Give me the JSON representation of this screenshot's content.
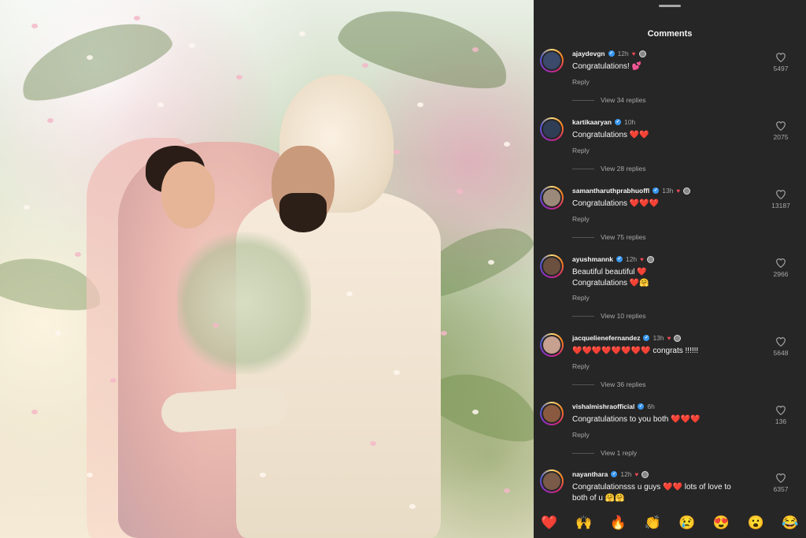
{
  "panel": {
    "title": "Comments"
  },
  "comments": [
    {
      "username": "ajaydevgn",
      "time": "12h",
      "text": "Congratulations! 💕",
      "reply": "Reply",
      "likes": "5497",
      "view_replies": "View 34 replies",
      "avatar_color": "#3b4a6b"
    },
    {
      "username": "kartikaaryan",
      "time": "10h",
      "text": "Congratulations ❤️❤️",
      "reply": "Reply",
      "likes": "2075",
      "view_replies": "View 28 replies",
      "avatar_color": "#2f3d55"
    },
    {
      "username": "samantharuthprabhuoffl",
      "time": "13h",
      "text": "Congratulations ❤️❤️❤️",
      "reply": "Reply",
      "likes": "13187",
      "view_replies": "View 75 replies",
      "avatar_color": "#9b8a7a"
    },
    {
      "username": "ayushmannk",
      "time": "12h",
      "text": "Beautiful beautiful ❤️",
      "text2": "Congratulations ❤️🤗",
      "reply": "Reply",
      "likes": "2966",
      "view_replies": "View 10 replies",
      "avatar_color": "#6b5040"
    },
    {
      "username": "jacquelienefernandez",
      "time": "13h",
      "text": "❤️❤️❤️❤️❤️❤️❤️❤️ congrats !!!!!!",
      "reply": "Reply",
      "likes": "5648",
      "view_replies": "View 36 replies",
      "avatar_color": "#c8a090"
    },
    {
      "username": "vishalmishraofficial",
      "time": "6h",
      "text": "Congratulations to you both ❤️❤️❤️",
      "reply": "Reply",
      "likes": "136",
      "view_replies": "View 1 reply",
      "avatar_color": "#8a5a40"
    },
    {
      "username": "nayanthara",
      "time": "12h",
      "text": "Congratulationsss u guys ❤️❤️ lots of love to",
      "text2": "both of u 🤗🤗",
      "likes": "6357",
      "avatar_color": "#7a5a48"
    }
  ],
  "reactions": [
    "❤️",
    "🙌",
    "🔥",
    "👏",
    "😢",
    "😍",
    "😮",
    "😂"
  ],
  "colors": {
    "panel_bg": "#262626",
    "muted": "#a8a8a8",
    "verified": "#3897f0",
    "heart": "#ed4956"
  }
}
